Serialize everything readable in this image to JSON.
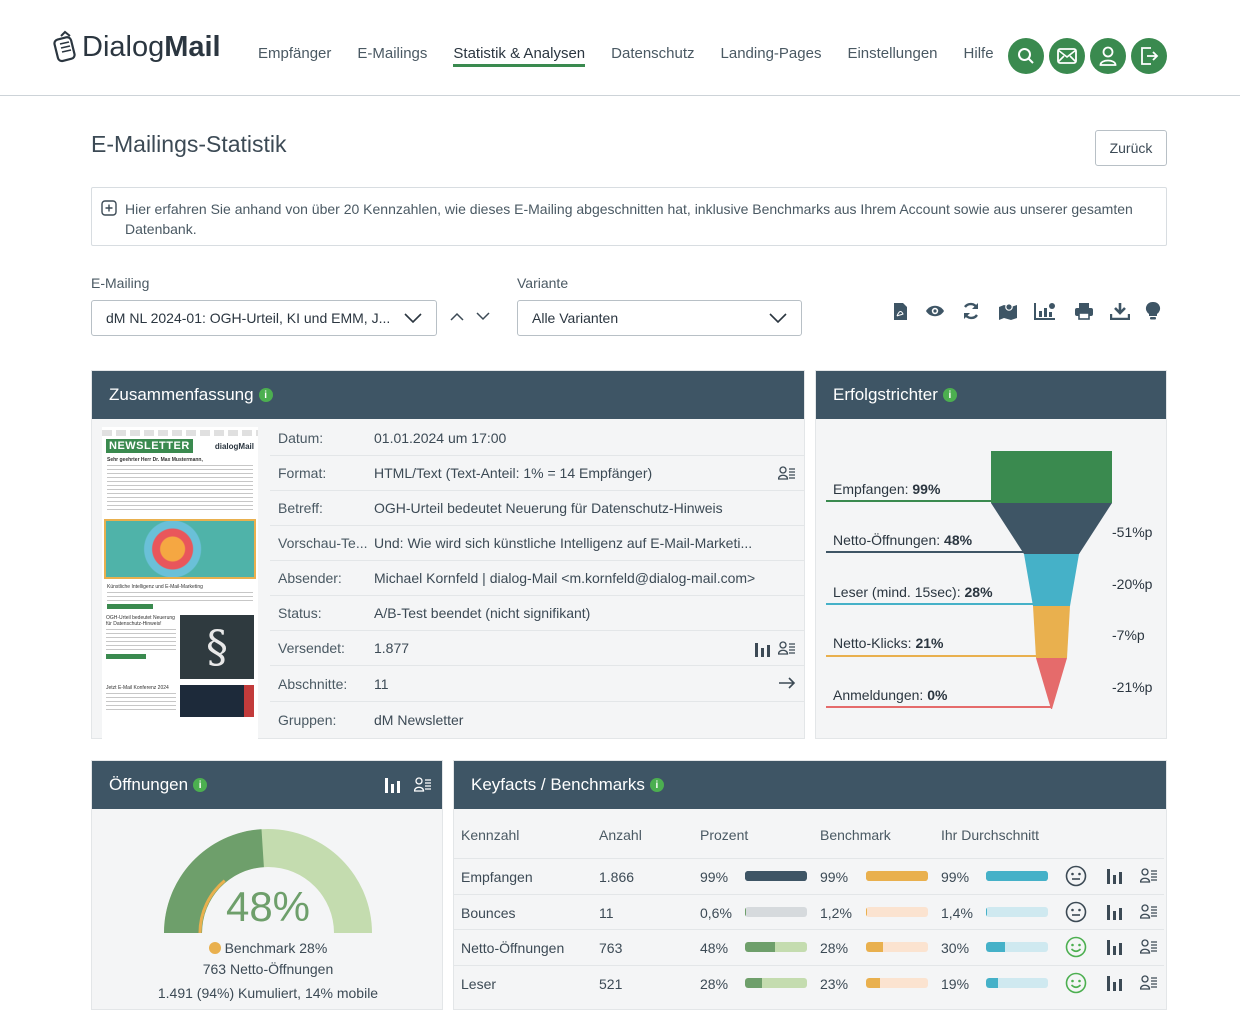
{
  "header": {
    "logo_light": "Dialog",
    "logo_bold": "Mail",
    "nav": [
      "Empfänger",
      "E-Mailings",
      "Statistik & Analysen",
      "Datenschutz",
      "Landing-Pages",
      "Einstellungen",
      "Hilfe"
    ],
    "accent": "#3a8a4f"
  },
  "page": {
    "title": "E-Mailings-Statistik",
    "back": "Zurück",
    "info": "Hier erfahren Sie anhand von über 20 Kennzahlen, wie dieses E-Mailing abgeschnitten hat, inklusive Benchmarks aus Ihrem Account sowie aus unserer gesamten Datenbank."
  },
  "filters": {
    "mailing_label": "E-Mailing",
    "mailing_value": "dM NL 2024-01: OGH-Urteil, KI und EMM, J...",
    "variant_label": "Variante",
    "variant_value": "Alle Varianten",
    "tools": [
      "pdf-icon",
      "eye-icon",
      "refresh-icon",
      "map-icon",
      "chart-icon",
      "print-icon",
      "download-icon",
      "bulb-icon"
    ]
  },
  "summary": {
    "title": "Zusammenfassung",
    "rows": [
      {
        "k": "Datum:",
        "v": "01.01.2024 um 17:00"
      },
      {
        "k": "Format:",
        "v": "HTML/Text (Text-Anteil: 1% = 14 Empfänger)"
      },
      {
        "k": "Betreff:",
        "v": "OGH-Urteil bedeutet Neuerung für Datenschutz-Hinweis"
      },
      {
        "k": "Vorschau-Te...",
        "v": "Und: Wie wird sich künstliche Intelligenz auf E-Mail-Marketi..."
      },
      {
        "k": "Absender:",
        "v": "Michael Kornfeld | dialog-Mail <m.kornfeld@dialog-mail.com>"
      },
      {
        "k": "Status:",
        "v": "A/B-Test beendet (nicht signifikant)"
      },
      {
        "k": "Versendet:",
        "v": "1.877"
      },
      {
        "k": "Abschnitte:",
        "v": "11"
      },
      {
        "k": "Gruppen:",
        "v": "dM Newsletter"
      }
    ],
    "newsletter": {
      "banner": "NEWSLETTER",
      "brand": "dialogMail",
      "greeting": "Sehr geehrter Herr Dr. Max Mustermann,",
      "ki_head": "Künstliche Intelligenz und E-Mail-Marketing",
      "ogh_head": "OGH-Urteil bedeutet Neuerung für Datenschutz-Hinweis!",
      "konf_head": "Jetzt E-Mail Konferenz 2024"
    }
  },
  "funnel": {
    "title": "Erfolgstrichter",
    "stages": [
      {
        "label": "Empfangen:",
        "value": "99%",
        "color": "#3a8a4f"
      },
      {
        "label": "Netto-Öffnungen:",
        "value": "48%",
        "color": "#3e5565"
      },
      {
        "label": "Leser (mind. 15sec):",
        "value": "28%",
        "color": "#45b1c8"
      },
      {
        "label": "Netto-Klicks:",
        "value": "21%",
        "color": "#e9b04e"
      },
      {
        "label": "Anmeldungen:",
        "value": "0%",
        "color": "#e56b6b"
      }
    ],
    "diffs": [
      "-51%p",
      "-20%p",
      "-7%p",
      "-21%p"
    ]
  },
  "opens": {
    "title": "Öffnungen",
    "percent": "48%",
    "percent_value": 48,
    "benchmark_value": 28,
    "benchmark": "Benchmark 28%",
    "line1": "763 Netto-Öffnungen",
    "line2": "1.491 (94%) Kumuliert, 14% mobile"
  },
  "keyfacts": {
    "title": "Keyfacts / Benchmarks",
    "headers": [
      "Kennzahl",
      "Anzahl",
      "Prozent",
      "Benchmark",
      "Ihr Durchschnitt"
    ],
    "rows": [
      {
        "name": "Empfangen",
        "count": "1.866",
        "pct": "99%",
        "pct_v": 99,
        "bm": "99%",
        "bm_v": 99,
        "avg": "99%",
        "avg_v": 99,
        "mood": "neutral"
      },
      {
        "name": "Bounces",
        "count": "11",
        "pct": "0,6%",
        "pct_v": 0.6,
        "bm": "1,2%",
        "bm_v": 1.2,
        "avg": "1,4%",
        "avg_v": 1.4,
        "mood": "neutral"
      },
      {
        "name": "Netto-Öffnungen",
        "count": "763",
        "pct": "48%",
        "pct_v": 48,
        "bm": "28%",
        "bm_v": 28,
        "avg": "30%",
        "avg_v": 30,
        "mood": "happy"
      },
      {
        "name": "Leser",
        "count": "521",
        "pct": "28%",
        "pct_v": 28,
        "bm": "23%",
        "bm_v": 23,
        "avg": "19%",
        "avg_v": 19,
        "mood": "happy"
      }
    ]
  }
}
